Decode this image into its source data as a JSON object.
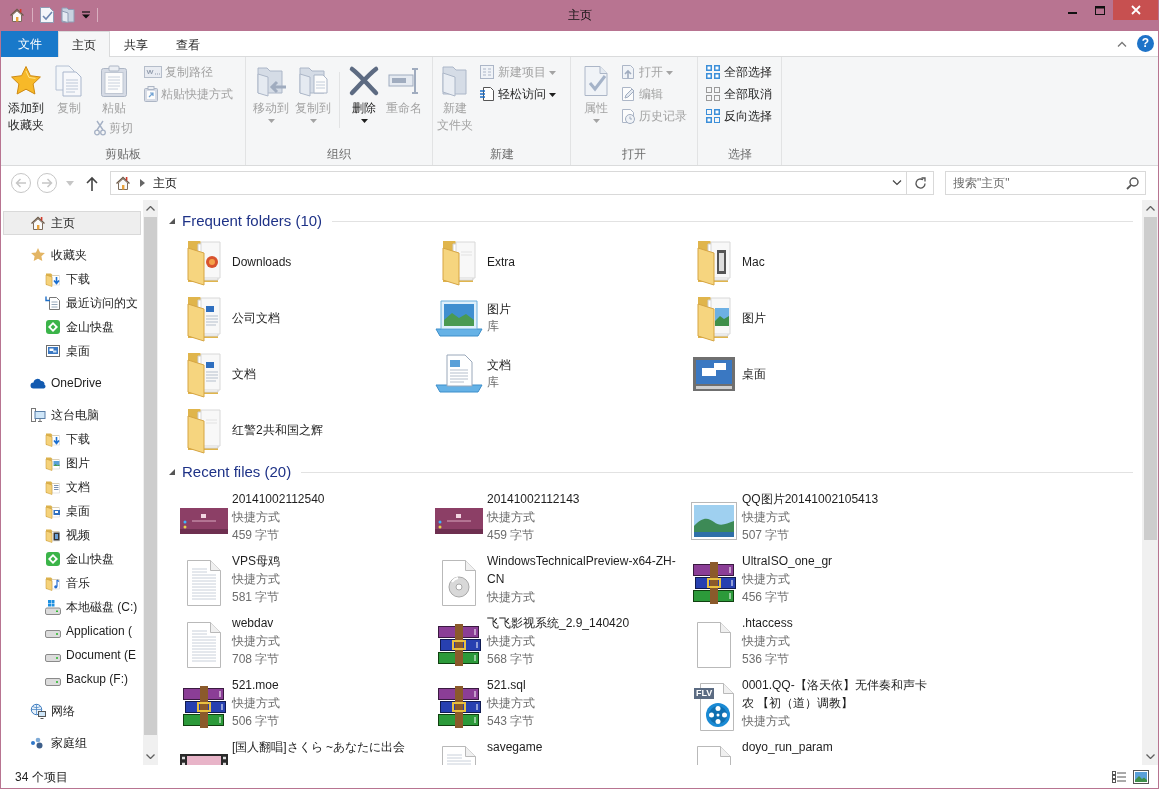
{
  "window": {
    "title": "主页"
  },
  "ribbon": {
    "tabs": [
      {
        "label": "文件",
        "kind": "file",
        "selected": false
      },
      {
        "label": "主页",
        "kind": "tab",
        "selected": true
      },
      {
        "label": "共享",
        "kind": "tab",
        "selected": false
      },
      {
        "label": "查看",
        "kind": "tab",
        "selected": false
      }
    ],
    "help": {
      "label": "?"
    },
    "groups": [
      {
        "label": "剪贴板",
        "columns": [
          {
            "kind": "large",
            "label_lines": [
              "添加到",
              "收藏夹"
            ],
            "disabled": false,
            "dropdown": false
          },
          {
            "kind": "large",
            "label": "复制",
            "disabled": true,
            "dropdown": false
          },
          {
            "kind": "large",
            "label": "粘贴",
            "disabled": true,
            "dropdown": false,
            "below": {
              "label": "剪切",
              "disabled": true,
              "dropdown": false
            }
          },
          {
            "kind": "stack",
            "buttons": [
              {
                "label": "复制路径",
                "disabled": true,
                "dropdown": false
              },
              {
                "label": "粘贴快捷方式",
                "disabled": true,
                "dropdown": false
              }
            ]
          }
        ]
      },
      {
        "label": "组织",
        "columns": [
          {
            "kind": "large",
            "label": "移动到",
            "disabled": true,
            "dropdown": true
          },
          {
            "kind": "large",
            "label": "复制到",
            "disabled": true,
            "dropdown": true
          },
          {
            "kind": "separator"
          },
          {
            "kind": "large",
            "label": "删除",
            "disabled": false,
            "dropdown": true
          },
          {
            "kind": "large",
            "label": "重命名",
            "disabled": true,
            "dropdown": false
          }
        ]
      },
      {
        "label": "新建",
        "columns": [
          {
            "kind": "large",
            "label_lines": [
              "新建",
              "文件夹"
            ],
            "disabled": true,
            "dropdown": false
          },
          {
            "kind": "stack",
            "buttons": [
              {
                "label": "新建项目",
                "disabled": true,
                "dropdown": true
              },
              {
                "label": "轻松访问",
                "disabled": false,
                "dropdown": true
              }
            ]
          }
        ]
      },
      {
        "label": "打开",
        "columns": [
          {
            "kind": "large",
            "label": "属性",
            "disabled": true,
            "dropdown": true
          },
          {
            "kind": "stack",
            "buttons": [
              {
                "label": "打开",
                "disabled": true,
                "dropdown": true
              },
              {
                "label": "编辑",
                "disabled": true,
                "dropdown": false
              },
              {
                "label": "历史记录",
                "disabled": true,
                "dropdown": false
              }
            ]
          }
        ]
      },
      {
        "label": "选择",
        "columns": [
          {
            "kind": "stack",
            "buttons": [
              {
                "label": "全部选择",
                "disabled": false,
                "dropdown": false
              },
              {
                "label": "全部取消",
                "disabled": false,
                "dropdown": false
              },
              {
                "label": "反向选择",
                "disabled": false,
                "dropdown": false
              }
            ]
          }
        ]
      }
    ]
  },
  "address_bar": {
    "nav_buttons": [
      {
        "kind": "back",
        "disabled": true
      },
      {
        "kind": "forward",
        "disabled": true
      },
      {
        "kind": "recent",
        "disabled": true
      },
      {
        "kind": "up",
        "disabled": false
      }
    ],
    "path": [
      "主页"
    ]
  },
  "search": {
    "placeholder": "搜索\"主页\""
  },
  "navigation_pane": {
    "items": [
      {
        "label": "主页",
        "kind": "home",
        "selected": true
      },
      {
        "label": "收藏夹",
        "kind": "favorites",
        "selected": false,
        "children": [
          {
            "label": "下载",
            "kind": "downloads",
            "selected": false
          },
          {
            "label": "最近访问的文",
            "kind": "recent",
            "selected": false
          },
          {
            "label": "金山快盘",
            "kind": "cloud_drive",
            "selected": false
          },
          {
            "label": "桌面",
            "kind": "desktop",
            "selected": false
          }
        ]
      },
      {
        "label": "OneDrive",
        "kind": "onedrive",
        "selected": false
      },
      {
        "label": "这台电脑",
        "kind": "computer",
        "selected": false,
        "children": [
          {
            "label": "下载",
            "kind": "downloads",
            "selected": false
          },
          {
            "label": "图片",
            "kind": "pictures",
            "selected": false
          },
          {
            "label": "文档",
            "kind": "documents",
            "selected": false
          },
          {
            "label": "桌面",
            "kind": "desktop_folder",
            "selected": false
          },
          {
            "label": "视频",
            "kind": "videos",
            "selected": false
          },
          {
            "label": "金山快盘",
            "kind": "cloud_drive",
            "selected": false
          },
          {
            "label": "音乐",
            "kind": "music",
            "selected": false
          },
          {
            "label": "本地磁盘 (C:)",
            "kind": "system_drive",
            "selected": false
          },
          {
            "label": "Application (",
            "kind": "drive",
            "selected": false
          },
          {
            "label": "Document (E",
            "kind": "drive",
            "selected": false
          },
          {
            "label": "Backup (F:)",
            "kind": "drive",
            "selected": false
          }
        ]
      },
      {
        "label": "网络",
        "kind": "network",
        "selected": false
      },
      {
        "label": "家庭组",
        "kind": "homegroup",
        "selected": false
      }
    ]
  },
  "content": {
    "sections": [
      {
        "title": "Frequent folders (10)",
        "expanded": true,
        "items": [
          {
            "name": "Downloads",
            "kind": "downloads_folder"
          },
          {
            "name": "Extra",
            "kind": "folder"
          },
          {
            "name": "Mac",
            "kind": "media_folder"
          },
          {
            "name": "公司文档",
            "kind": "document_folder"
          },
          {
            "name": "图片",
            "subtitle": "库",
            "kind": "picture_library"
          },
          {
            "name": "图片",
            "kind": "picture_folder"
          },
          {
            "name": "文档",
            "kind": "document_folder"
          },
          {
            "name": "文档",
            "subtitle": "库",
            "kind": "document_library"
          },
          {
            "name": "桌面",
            "kind": "desktop"
          },
          {
            "name": "红警2共和国之辉",
            "kind": "folder"
          }
        ]
      },
      {
        "title": "Recent files (20)",
        "expanded": true,
        "items": [
          {
            "name": "20141002112540",
            "type": "快捷方式",
            "size": "459 字节",
            "kind": "slide"
          },
          {
            "name": "20141002112143",
            "type": "快捷方式",
            "size": "459 字节",
            "kind": "slide"
          },
          {
            "name": "QQ图片20141002105413",
            "type": "快捷方式",
            "size": "507 字节",
            "kind": "photo"
          },
          {
            "name": "VPS母鸡",
            "type": "快捷方式",
            "size": "581 字节",
            "kind": "text"
          },
          {
            "name": "WindowsTechnicalPreview-x64-ZH-CN",
            "type": "快捷方式",
            "kind": "disc"
          },
          {
            "name": "UltraISO_one_gr",
            "type": "快捷方式",
            "size": "456 字节",
            "kind": "archive"
          },
          {
            "name": "webdav",
            "type": "快捷方式",
            "size": "708 字节",
            "kind": "text"
          },
          {
            "name": "飞飞影视系统_2.9_140420",
            "type": "快捷方式",
            "size": "568 字节",
            "kind": "archive"
          },
          {
            "name": ".htaccess",
            "type": "快捷方式",
            "size": "536 字节",
            "kind": "blank"
          },
          {
            "name": "521.moe",
            "type": "快捷方式",
            "size": "506 字节",
            "kind": "archive"
          },
          {
            "name": "521.sql",
            "type": "快捷方式",
            "size": "543 字节",
            "kind": "archive"
          },
          {
            "name": "0001.QQ-【洛天依】无伴奏和声卡农 【初（道）调教】",
            "type": "快捷方式",
            "kind": "video_file",
            "icon_label": "FLV"
          },
          {
            "name": "[国人翻唱]さくら ~あなたに出会",
            "kind": "video_thumb"
          },
          {
            "name": "savegame",
            "kind": "text"
          },
          {
            "name": "doyo_run_param",
            "kind": "settings_file"
          }
        ]
      }
    ]
  },
  "status_bar": {
    "item_count": "34 个项目",
    "views": [
      {
        "kind": "details",
        "selected": false
      },
      {
        "kind": "large_icons",
        "selected": false
      }
    ]
  }
}
